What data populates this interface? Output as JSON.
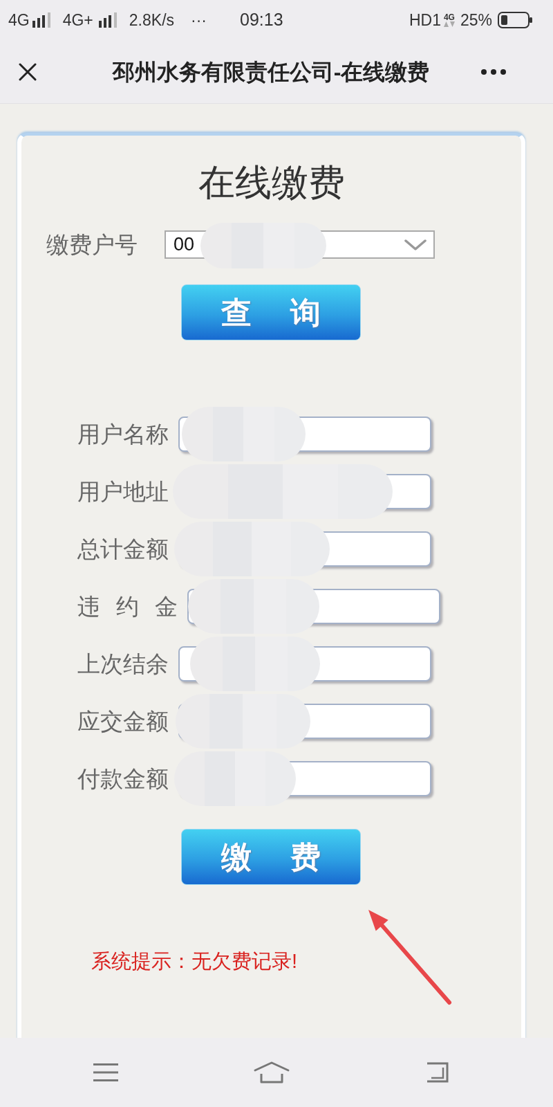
{
  "status_bar": {
    "sim1": "4G",
    "sim2": "4G+",
    "speed": "2.8K/s",
    "notifications": "···",
    "time": "09:13",
    "hd": "HD1",
    "data_network": "4G",
    "battery": "25%"
  },
  "title_bar": {
    "title": "邳州水务有限责任公司-在线缴费"
  },
  "form": {
    "title": "在线缴费",
    "account": {
      "label": "缴费户号",
      "value": "00",
      "blurred": true
    },
    "query_button": "查 询",
    "fields": [
      {
        "label": "用户名称",
        "blurred": true
      },
      {
        "label": "用户地址",
        "blurred": true
      },
      {
        "label": "总计金额",
        "blurred": true
      },
      {
        "label": "违 约 金",
        "blurred": true
      },
      {
        "label": "上次结余",
        "blurred": true
      },
      {
        "label": "应交金额",
        "blurred": true
      },
      {
        "label": "付款金额",
        "blurred": true
      }
    ],
    "pay_button": "缴 费",
    "message": "系统提示：无欠费记录!"
  }
}
